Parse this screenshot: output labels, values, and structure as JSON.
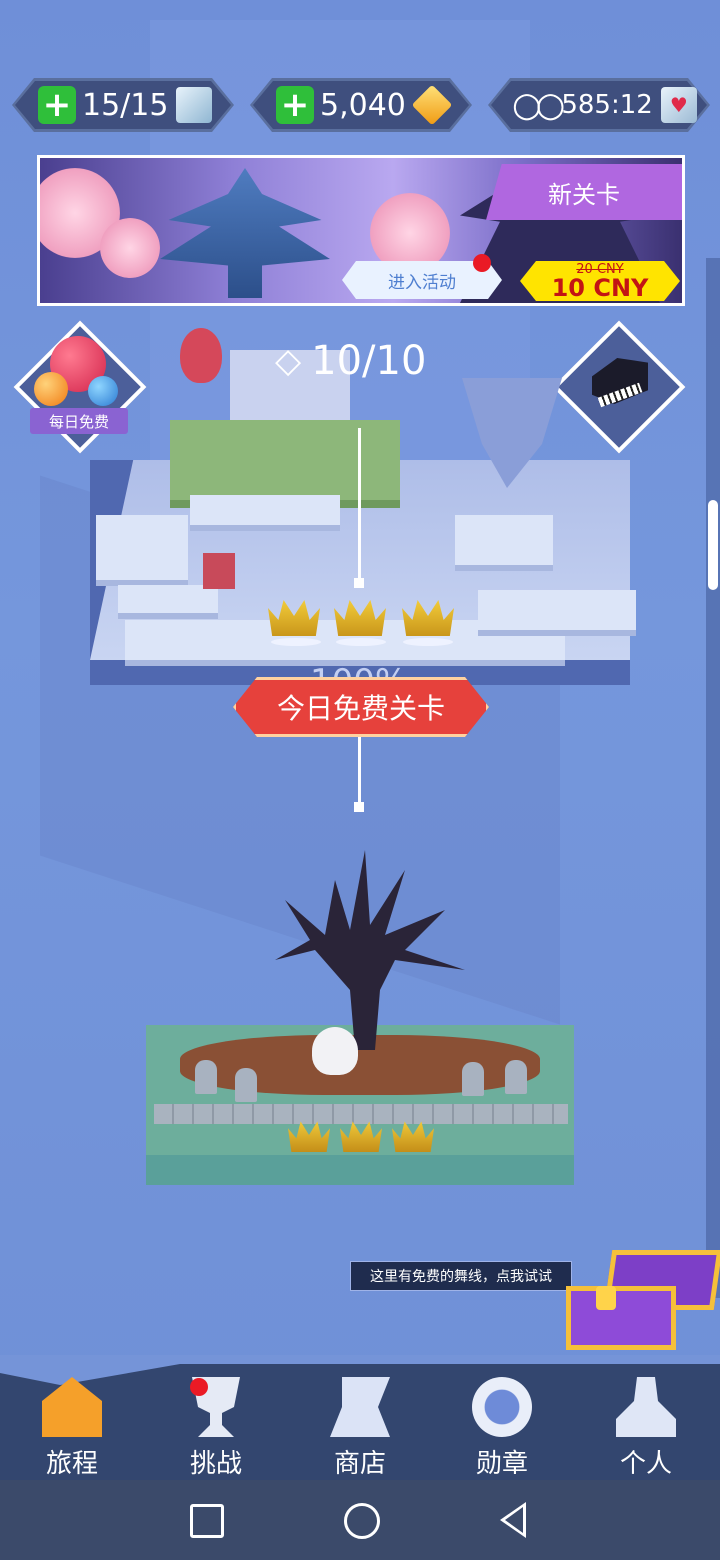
{
  "counters": {
    "energy": "15/15",
    "coins": "5,040",
    "timer": "585:12"
  },
  "banner": {
    "new_level": "新关卡",
    "enter_event": "进入活动",
    "price_old": "20 CNY",
    "price_new": "10 CNY"
  },
  "left_badge": "每日免费",
  "gems": "10/10",
  "level_progress": "100%",
  "free_level_button": "今日免费关卡",
  "chest_tip": "这里有免费的舞线，点我试试",
  "nav": {
    "items": [
      {
        "label": "旅程",
        "icon": "house-icon"
      },
      {
        "label": "挑战",
        "icon": "trophy-icon"
      },
      {
        "label": "商店",
        "icon": "shop-icon"
      },
      {
        "label": "勋章",
        "icon": "medal-icon"
      },
      {
        "label": "个人",
        "icon": "person-icon"
      }
    ]
  },
  "colors": {
    "background": "#7090d6",
    "free_button": "#e6413c",
    "gold": "#f5c03a",
    "plus_green": "#2fbf3a"
  }
}
